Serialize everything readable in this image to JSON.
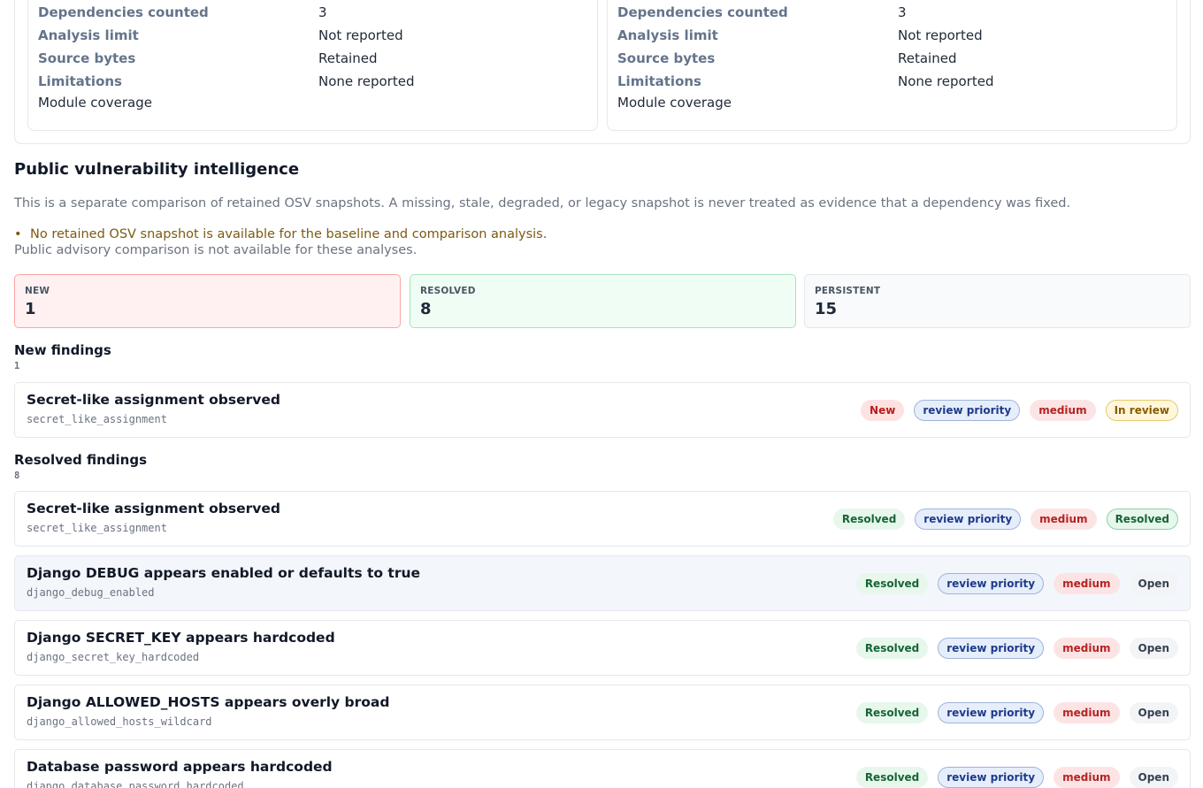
{
  "analysis_cards": [
    {
      "rows": [
        {
          "key": "Dependencies counted",
          "value": "3"
        },
        {
          "key": "Analysis limit",
          "value": "Not reported"
        },
        {
          "key": "Source bytes",
          "value": "Retained"
        },
        {
          "key": "Limitations",
          "value": "None reported"
        }
      ],
      "module_coverage": "Module coverage"
    },
    {
      "rows": [
        {
          "key": "Dependencies counted",
          "value": "3"
        },
        {
          "key": "Analysis limit",
          "value": "Not reported"
        },
        {
          "key": "Source bytes",
          "value": "Retained"
        },
        {
          "key": "Limitations",
          "value": "None reported"
        }
      ],
      "module_coverage": "Module coverage"
    }
  ],
  "osv": {
    "title": "Public vulnerability intelligence",
    "description": "This is a separate comparison of retained OSV snapshots. A missing, stale, degraded, or legacy snapshot is never treated as evidence that a dependency was fixed.",
    "warning_bullet": "•",
    "warning": "No retained OSV snapshot is available for the baseline and comparison analysis.",
    "not_available": "Public advisory comparison is not available for these analyses."
  },
  "stats": {
    "new": {
      "label": "NEW",
      "value": "1"
    },
    "resolved": {
      "label": "RESOLVED",
      "value": "8"
    },
    "persistent": {
      "label": "PERSISTENT",
      "value": "15"
    }
  },
  "new_findings": {
    "title": "New findings",
    "count": "1",
    "items": [
      {
        "title": "Secret-like assignment observed",
        "code": "secret_like_assignment",
        "badges": [
          "New",
          "review priority",
          "medium",
          "In review"
        ]
      }
    ]
  },
  "resolved_findings": {
    "title": "Resolved findings",
    "count": "8",
    "items": [
      {
        "title": "Secret-like assignment observed",
        "code": "secret_like_assignment",
        "badges": [
          "Resolved",
          "review priority",
          "medium",
          "Resolved"
        ]
      },
      {
        "title": "Django DEBUG appears enabled or defaults to true",
        "code": "django_debug_enabled",
        "badges": [
          "Resolved",
          "review priority",
          "medium",
          "Open"
        ]
      },
      {
        "title": "Django SECRET_KEY appears hardcoded",
        "code": "django_secret_key_hardcoded",
        "badges": [
          "Resolved",
          "review priority",
          "medium",
          "Open"
        ]
      },
      {
        "title": "Django ALLOWED_HOSTS appears overly broad",
        "code": "django_allowed_hosts_wildcard",
        "badges": [
          "Resolved",
          "review priority",
          "medium",
          "Open"
        ]
      },
      {
        "title": "Database password appears hardcoded",
        "code": "django_database_password_hardcoded",
        "badges": [
          "Resolved",
          "review priority",
          "medium",
          "Open"
        ]
      }
    ]
  }
}
